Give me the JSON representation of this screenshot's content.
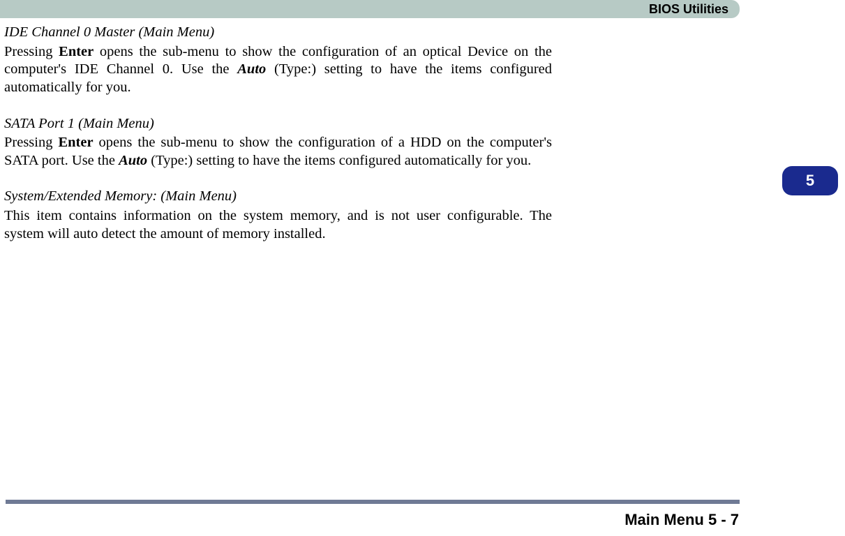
{
  "header": {
    "title": "BIOS Utilities"
  },
  "chapter": {
    "number": "5"
  },
  "sections": [
    {
      "heading": "IDE Channel 0 Master (Main Menu)",
      "para": {
        "pre1": "Pressing ",
        "b1": "Enter",
        "mid1": " opens the sub-menu to show the configuration of an optical Device on the computer's IDE Channel 0. Use the ",
        "bi1": "Auto",
        "post1": " (Type:) setting to have the items configured automatically for you."
      }
    },
    {
      "heading": "SATA Port 1 (Main Menu)",
      "para": {
        "pre1": "Pressing ",
        "b1": "Enter",
        "mid1": " opens the sub-menu to show the configuration of a HDD on the computer's SATA port. Use the ",
        "bi1": "Auto",
        "post1": " (Type:) setting to have the items configured automatically for you."
      }
    },
    {
      "heading": "System/Extended Memory: (Main Menu)",
      "para": {
        "text": "This item contains information on the system memory, and is not user configurable. The system will auto detect the amount of memory installed."
      }
    }
  ],
  "footer": {
    "text": "Main Menu  5  -  7"
  }
}
